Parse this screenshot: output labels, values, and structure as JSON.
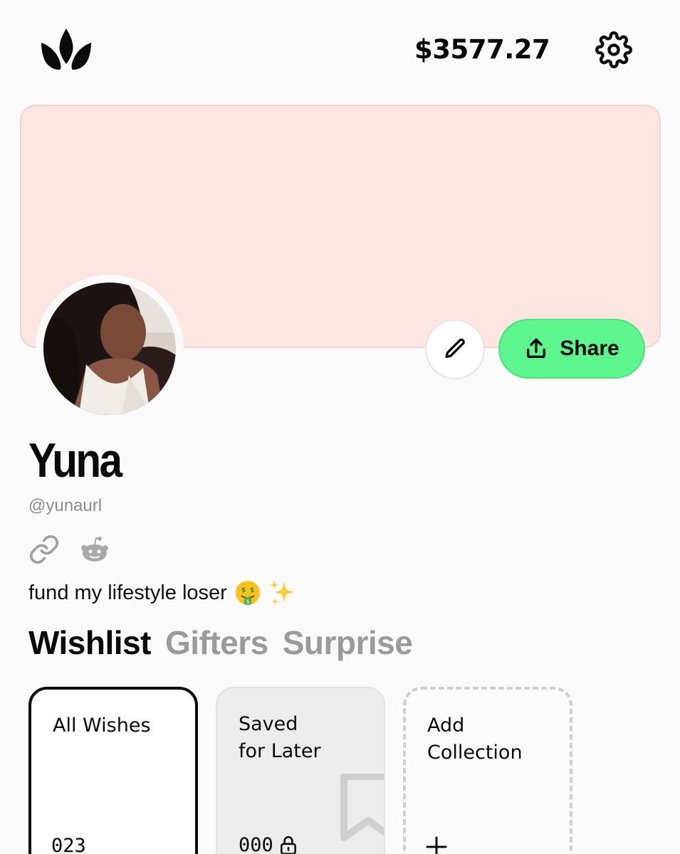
{
  "header": {
    "logo_icon": "crown-flame-logo",
    "balance": "$3577.27",
    "settings_icon": "gear-icon"
  },
  "profile": {
    "banner_color": "#fde6e2",
    "name": "Yuna",
    "handle": "@yunaurl",
    "bio": "fund my lifestyle loser",
    "bio_emojis": [
      "money-mouth-face",
      "sparkles"
    ],
    "social_icons": [
      "link-icon",
      "reddit-icon"
    ]
  },
  "actions": {
    "edit_icon": "pencil-icon",
    "share_label": "Share",
    "share_color": "#5df58e"
  },
  "tabs": [
    {
      "label": "Wishlist",
      "active": true
    },
    {
      "label": "Gifters",
      "active": false
    },
    {
      "label": "Surprise",
      "active": false
    }
  ],
  "collections": [
    {
      "title": "All Wishes",
      "count": "023"
    },
    {
      "title": "Saved\nfor Later",
      "count": "000",
      "locked": true
    },
    {
      "title": "Add\nCollection",
      "icon": "plus-icon"
    }
  ]
}
